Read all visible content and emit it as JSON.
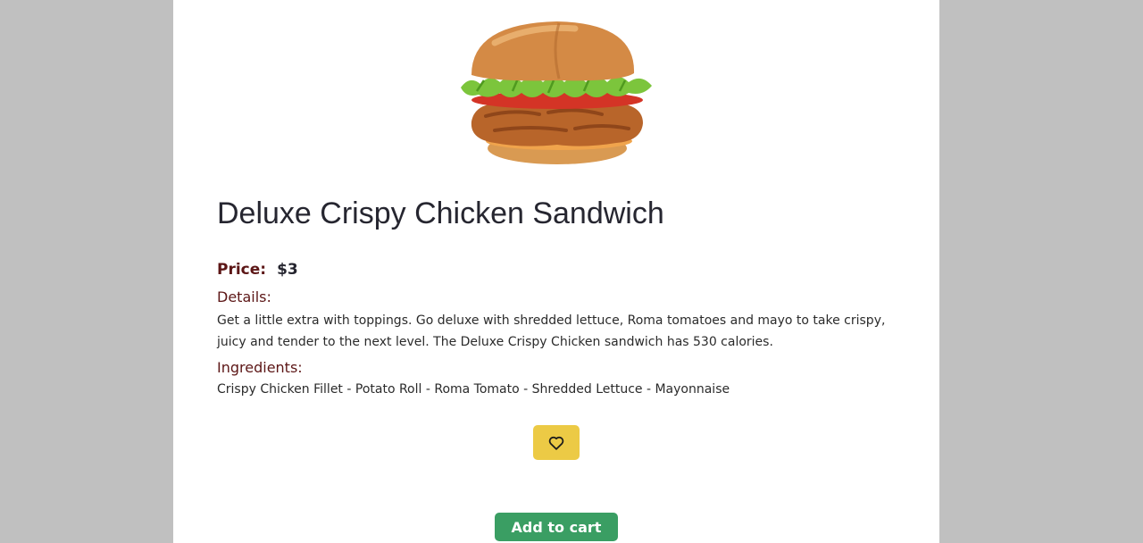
{
  "product": {
    "image_alt": "Deluxe Crispy Chicken Sandwich",
    "title": "Deluxe Crispy Chicken Sandwich",
    "price_label": "Price:",
    "price_value": "$3",
    "details_heading": "Details:",
    "details_text": "Get a little extra with toppings. Go deluxe with shredded lettuce, Roma tomatoes and mayo to take crispy, juicy and tender to the next level. The Deluxe Crispy Chicken sandwich has 530 calories.",
    "ingredients_heading": "Ingredients:",
    "ingredients_text": "Crispy Chicken Fillet - Potato Roll - Roma Tomato - Shredded Lettuce - Mayonnaise"
  },
  "actions": {
    "favorite_icon": "heart-outline-icon",
    "add_to_cart_label": "Add to cart"
  },
  "colors": {
    "page_background": "#c0c0c0",
    "card_background": "#ffffff",
    "heading_accent": "#5c1616",
    "favorite_button": "#ecca45",
    "add_to_cart_button": "#3a9e63"
  }
}
